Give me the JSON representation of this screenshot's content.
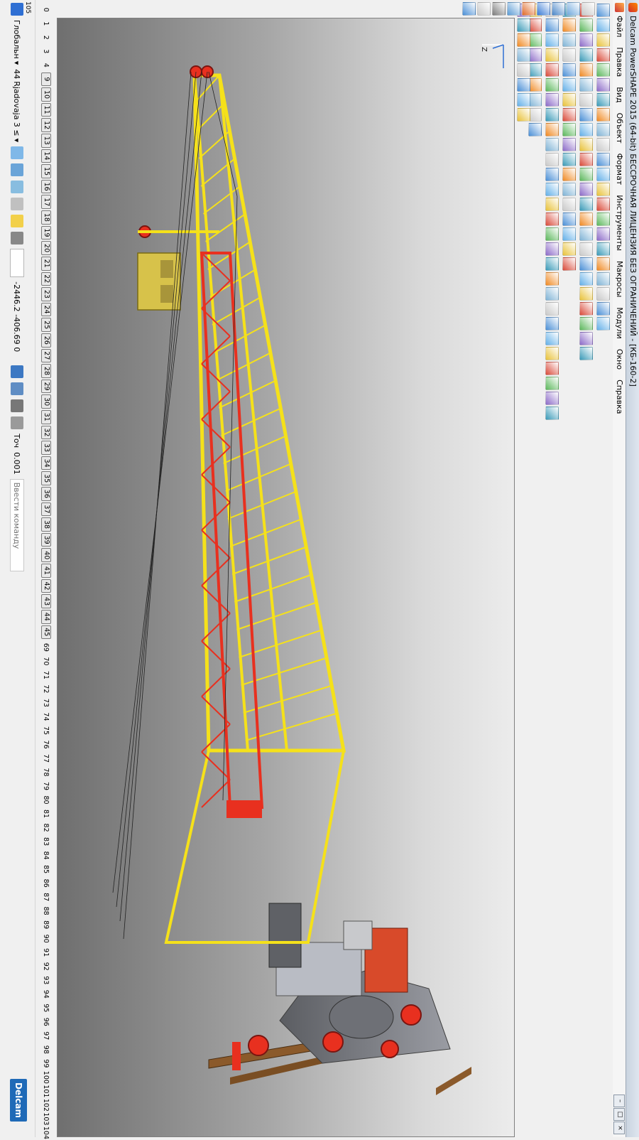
{
  "window": {
    "title": "Delcam PowerSHAPE 2015 (64-bit) БЕССРОЧНАЯ ЛИЦЕНЗИЯ БЕЗ ОГРАНИЧЕНИЙ - [КБ-160-2]",
    "controls": [
      "–",
      "□",
      "×"
    ]
  },
  "menu": [
    "Файл",
    "Правка",
    "Вид",
    "Объект",
    "Формат",
    "Инструменты",
    "Макросы",
    "Модули",
    "Окно",
    "Справка"
  ],
  "layers": {
    "corner_label": "105",
    "plain_start": [
      "0",
      "1",
      "2",
      "3",
      "4"
    ],
    "boxed": [
      "9",
      "10",
      "11",
      "12",
      "13",
      "14",
      "15",
      "16",
      "17",
      "18",
      "19",
      "20",
      "21",
      "22",
      "23",
      "24",
      "25",
      "26",
      "27",
      "28",
      "29",
      "30",
      "31",
      "32",
      "33",
      "34",
      "35",
      "36",
      "37",
      "38",
      "39",
      "40",
      "41",
      "42",
      "43",
      "44",
      "45"
    ],
    "plain_end": [
      "69",
      "70",
      "71",
      "72",
      "73",
      "74",
      "75",
      "76",
      "77",
      "78",
      "79",
      "80",
      "81",
      "82",
      "83",
      "84",
      "85",
      "86",
      "87",
      "88",
      "89",
      "90",
      "91",
      "92",
      "93",
      "94",
      "95",
      "96",
      "97",
      "98",
      "99",
      "100",
      "101",
      "102",
      "103",
      "104"
    ]
  },
  "statusbar": {
    "workplane_label": "Глобальн",
    "layer_number": "44",
    "layer_name": "Rjadovaja 3 ≤",
    "coord_x": "-2446.2",
    "coord_y": "-406.69",
    "coord_z": "0",
    "point_label": "Точ",
    "tolerance": "0.001",
    "command_placeholder": "Ввести команду",
    "logo_text": "Delcam"
  },
  "axes": {
    "z_label": "Z"
  },
  "colors": {
    "crane_yellow": "#f5e11a",
    "crane_red": "#e8301f",
    "rail_brown": "#8b5a2b",
    "base_gray": "#7d7f86",
    "counterweight": "#5f6166"
  }
}
